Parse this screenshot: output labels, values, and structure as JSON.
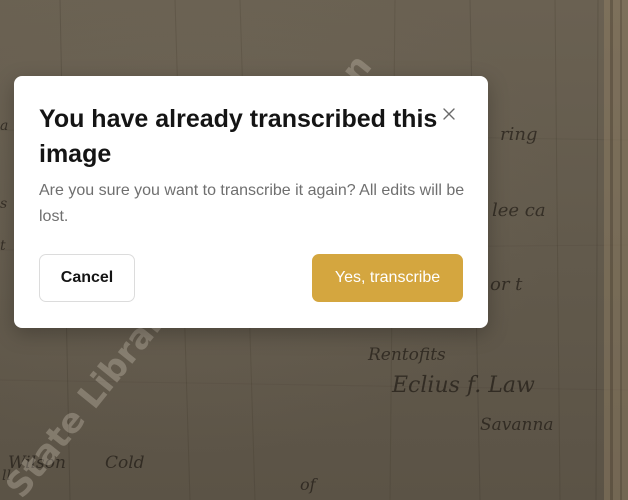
{
  "dialog": {
    "title": "You have already transcribed this image",
    "message": "Are you sure you want to transcribe it again? All edits will be lost.",
    "cancel_label": "Cancel",
    "confirm_label": "Yes, transcribe"
  },
  "background": {
    "watermark": "State Library and Permission",
    "handwriting": [
      "ring",
      "lee ca",
      "or t",
      "Rentofits",
      "Eclius f. Law",
      "Savanna",
      "Wilson",
      "Cold"
    ]
  },
  "colors": {
    "confirm_button": "#d4a63f",
    "backdrop": "#5f564a",
    "title_text": "#141414",
    "message_text": "#6f6f6f"
  },
  "icons": {
    "close": "close-icon"
  }
}
